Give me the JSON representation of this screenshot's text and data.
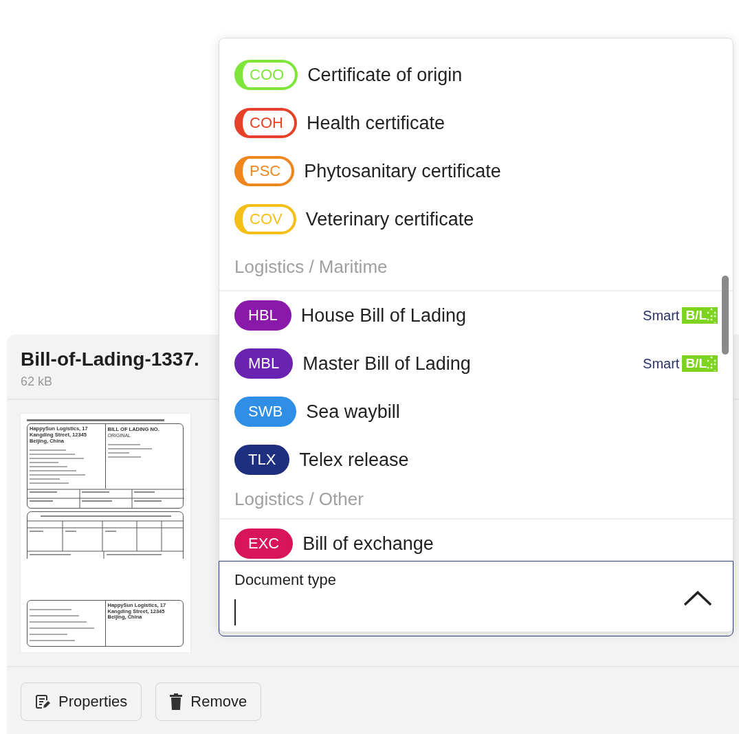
{
  "file": {
    "name": "Bill-of-Lading-1337.",
    "size": "62 kB",
    "thumbnail": {
      "header_company": "HappySun Logistics, 17 Kangding Street, 12345 Beijing, China",
      "title": "BILL OF LADING NO.",
      "title_note": "ORIGINAL",
      "footer_company": "HappySun Logistics, 17 Kangding Street, 12345 Beijing, China"
    },
    "buttons": [
      {
        "label": "Properties",
        "kind": "properties"
      },
      {
        "label": "Remove",
        "kind": "remove"
      }
    ]
  },
  "dropdown": {
    "expanded": true,
    "groups": [
      {
        "items": [
          {
            "code": "COO",
            "label": "Certificate of origin",
            "kind": "outline",
            "color": "#7ee63a"
          },
          {
            "code": "COH",
            "label": "Health certificate",
            "kind": "outline",
            "color": "#e8412a"
          },
          {
            "code": "PSC",
            "label": "Phytosanitary certificate",
            "kind": "outline",
            "color": "#f0861e"
          },
          {
            "code": "COV",
            "label": "Veterinary certificate",
            "kind": "outline",
            "color": "#f5bf1a"
          }
        ]
      },
      {
        "header": "Logistics / Maritime",
        "items": [
          {
            "code": "HBL",
            "label": "House Bill of Lading",
            "kind": "filled",
            "color": "#8a18a8",
            "logo": {
              "word": "Smart",
              "mark": "B/L"
            }
          },
          {
            "code": "MBL",
            "label": "Master Bill of Lading",
            "kind": "filled",
            "color": "#6a22b0",
            "logo": {
              "word": "Smart",
              "mark": "B/L"
            }
          },
          {
            "code": "SWB",
            "label": "Sea waybill",
            "kind": "filled",
            "color": "#2f8fe6"
          },
          {
            "code": "TLX",
            "label": "Telex release",
            "kind": "filled",
            "color": "#1f2f80"
          }
        ]
      },
      {
        "header": "Logistics / Other",
        "items": [
          {
            "code": "EXC",
            "label": "Bill of exchange",
            "kind": "filled",
            "color": "#d8145a"
          }
        ]
      }
    ],
    "field": {
      "label": "Document type",
      "focused": true
    }
  }
}
